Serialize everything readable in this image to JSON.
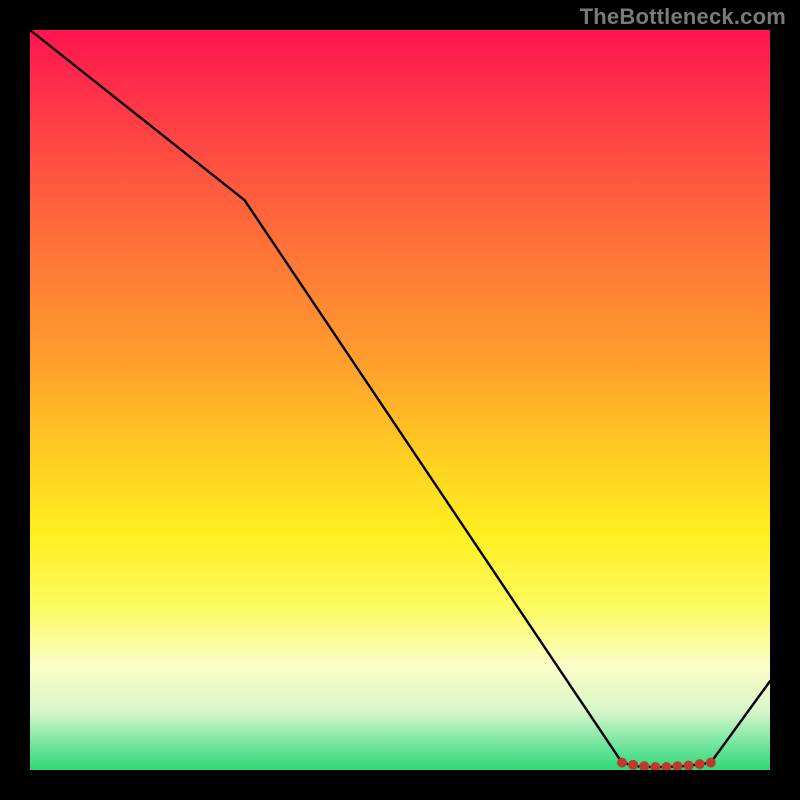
{
  "watermark": "TheBottleneck.com",
  "chart_data": {
    "type": "line",
    "title": "",
    "xlabel": "",
    "ylabel": "",
    "xlim": [
      0,
      100
    ],
    "ylim": [
      0,
      100
    ],
    "grid": false,
    "legend": false,
    "series": [
      {
        "name": "curve",
        "x": [
          0,
          29,
          80,
          82,
          84,
          86,
          88,
          90,
          92,
          100
        ],
        "values": [
          100,
          77,
          1,
          0.5,
          0.4,
          0.4,
          0.5,
          0.7,
          1,
          12
        ]
      }
    ],
    "markers": {
      "name": "flat-region-markers",
      "x": [
        80,
        81.5,
        83,
        84.5,
        86,
        87.5,
        89,
        90.5,
        92
      ],
      "values": [
        1,
        0.7,
        0.5,
        0.4,
        0.4,
        0.5,
        0.6,
        0.8,
        1
      ],
      "color": "#c0392b",
      "radius": 5
    },
    "background_gradient": {
      "stops": [
        {
          "pct": 0,
          "color": "#ff1450"
        },
        {
          "pct": 20,
          "color": "#ff5640"
        },
        {
          "pct": 46,
          "color": "#ffa22c"
        },
        {
          "pct": 68,
          "color": "#ffee20"
        },
        {
          "pct": 86,
          "color": "#fbfcc8"
        },
        {
          "pct": 100,
          "color": "#2ed877"
        }
      ]
    }
  }
}
